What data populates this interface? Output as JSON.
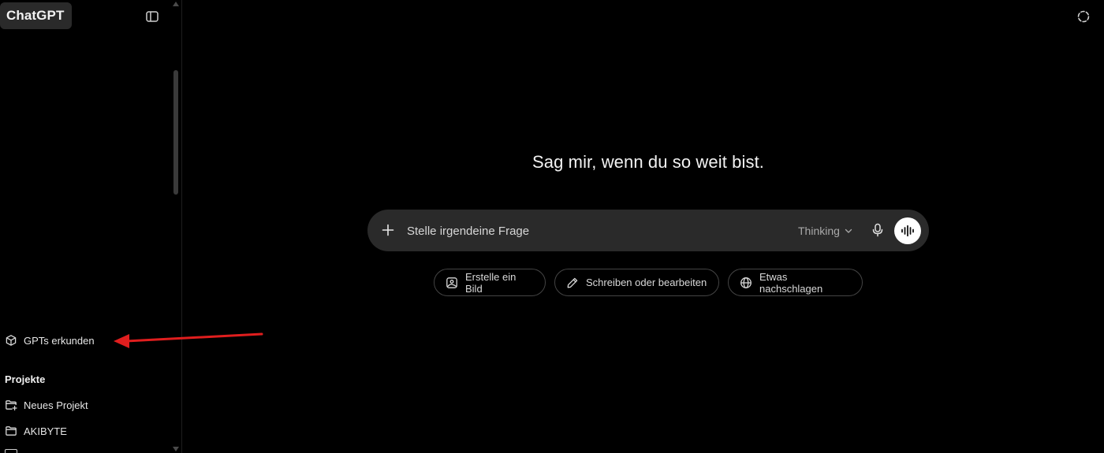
{
  "app": {
    "brand": "ChatGPT"
  },
  "sidebar": {
    "explore_label": "GPTs erkunden",
    "projects_heading": "Projekte",
    "projects": [
      {
        "label": "Neues Projekt",
        "icon": "folder-plus-icon"
      },
      {
        "label": "AKIBYTE",
        "icon": "folder-icon"
      }
    ]
  },
  "main": {
    "heading": "Sag mir, wenn du so weit bist.",
    "composer": {
      "placeholder": "Stelle irgendeine Frage",
      "model": "Thinking"
    },
    "suggestions": [
      {
        "label": "Erstelle ein Bild",
        "icon": "image-icon"
      },
      {
        "label": "Schreiben oder bearbeiten",
        "icon": "pencil-icon"
      },
      {
        "label": "Etwas nachschlagen",
        "icon": "globe-icon"
      }
    ]
  },
  "annotation": {
    "arrow_color": "#e01e1e"
  }
}
